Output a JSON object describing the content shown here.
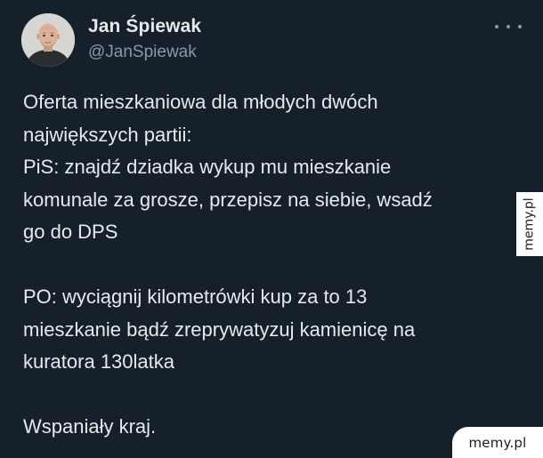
{
  "author": {
    "display_name": "Jan Śpiewak",
    "handle": "@JanSpiewak",
    "avatar_icon": "profile-photo"
  },
  "more_icon": "more-horizontal-icon",
  "tweet": {
    "paragraphs": [
      "Oferta mieszkaniowa dla młodych dwóch\nnajwiększych partii:\nPiS: znajdź dziadka wykup mu mieszkanie\nkomunale za grosze, przepisz na siebie, wsadź\ngo do DPS",
      "PO: wyciągnij kilometrówki kup za to 13\nmieszkanie bądź zreprywatyzuj kamienicę na\nkuratora 130latka",
      "Wspaniały kraj."
    ]
  },
  "watermarks": {
    "side": "memy.pl",
    "corner": "memy.pl"
  },
  "colors": {
    "background": "#15202b",
    "text": "#e7e9ea",
    "secondary_text": "#8b98a5",
    "watermark_bg": "#ffffff"
  }
}
